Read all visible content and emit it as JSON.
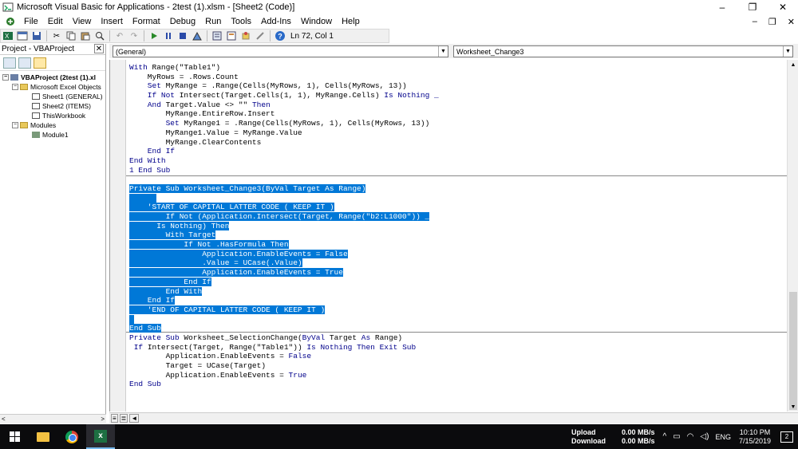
{
  "window": {
    "title": "Microsoft Visual Basic for Applications - 2test (1).xlsm - [Sheet2 (Code)]",
    "minimize": "–",
    "restore": "❐",
    "close": "✕"
  },
  "menu": {
    "items": [
      "File",
      "Edit",
      "View",
      "Insert",
      "Format",
      "Debug",
      "Run",
      "Tools",
      "Add-Ins",
      "Window",
      "Help"
    ],
    "mdi_minimize": "–",
    "mdi_restore": "❐",
    "mdi_close": "✕"
  },
  "toolbar": {
    "position": "Ln 72, Col 1"
  },
  "project": {
    "header": "Project - VBAProject",
    "close": "✕",
    "tree": [
      {
        "label": "VBAProject (2test (1).xl",
        "level": 0,
        "toggle": "−",
        "icon": "project-icon",
        "bold": true
      },
      {
        "label": "Microsoft Excel Objects",
        "level": 1,
        "toggle": "−",
        "icon": "folder-icon"
      },
      {
        "label": "Sheet1 (GENERAL)",
        "level": 2,
        "toggle": "",
        "icon": "sheet-icon"
      },
      {
        "label": "Sheet2 (ITEMS)",
        "level": 2,
        "toggle": "",
        "icon": "sheet-icon"
      },
      {
        "label": "ThisWorkbook",
        "level": 2,
        "toggle": "",
        "icon": "workbook-icon"
      },
      {
        "label": "Modules",
        "level": 1,
        "toggle": "−",
        "icon": "folder-icon"
      },
      {
        "label": "Module1",
        "level": 2,
        "toggle": "",
        "icon": "module-icon"
      }
    ],
    "scroll_left": "<",
    "scroll_right": ">"
  },
  "code": {
    "object_combo": "(General)",
    "procedure_combo": "Worksheet_Change3",
    "combo_arrow": "▼",
    "block1": [
      [
        {
          "t": "With ",
          "k": 1
        },
        {
          "t": "Range(\"Table1\")",
          "k": 0
        }
      ],
      [
        {
          "t": "    MyRows = .Rows.Count",
          "k": 0
        }
      ],
      [
        {
          "t": "    Set ",
          "k": 1
        },
        {
          "t": "MyRange = .Range(Cells(MyRows, 1), Cells(MyRows, 13))",
          "k": 0
        }
      ],
      [
        {
          "t": "    If Not ",
          "k": 1
        },
        {
          "t": "Intersect(Target.Cells(1, 1), MyRange.Cells) ",
          "k": 0
        },
        {
          "t": "Is Nothing _",
          "k": 1
        }
      ],
      [
        {
          "t": "    And ",
          "k": 1
        },
        {
          "t": "Target.Value <> \"\" ",
          "k": 0
        },
        {
          "t": "Then",
          "k": 1
        }
      ],
      [
        {
          "t": "        MyRange.EntireRow.Insert",
          "k": 0
        }
      ],
      [
        {
          "t": "        Set ",
          "k": 1
        },
        {
          "t": "MyRange1 = .Range(Cells(MyRows, 1), Cells(MyRows, 13))",
          "k": 0
        }
      ],
      [
        {
          "t": "        MyRange1.Value = MyRange.Value",
          "k": 0
        }
      ],
      [
        {
          "t": "        MyRange.ClearContents",
          "k": 0
        }
      ],
      [
        {
          "t": "    End If",
          "k": 1
        }
      ],
      [
        {
          "t": "End With",
          "k": 1
        }
      ],
      [
        {
          "t": "1 End Sub",
          "k": 1
        }
      ]
    ],
    "block2_selected": [
      "Private Sub Worksheet_Change3(ByVal Target As Range)",
      "      ",
      "    'START OF CAPITAL LATTER CODE ( KEEP IT )",
      "        If Not (Application.Intersect(Target, Range(\"b2:L1000\")) _",
      "      Is Nothing) Then",
      "        With Target",
      "            If Not .HasFormula Then",
      "                Application.EnableEvents = False",
      "                .Value = UCase(.Value)",
      "                Application.EnableEvents = True",
      "            End If",
      "        End With",
      "    End If",
      "    'END OF CAPITAL LATTER CODE ( KEEP IT )",
      " ",
      "End Sub"
    ],
    "block3": [
      [
        {
          "t": "Private Sub ",
          "k": 1
        },
        {
          "t": "Worksheet_SelectionChange(",
          "k": 0
        },
        {
          "t": "ByVal ",
          "k": 1
        },
        {
          "t": "Target ",
          "k": 0
        },
        {
          "t": "As ",
          "k": 1
        },
        {
          "t": "Range)",
          "k": 0
        }
      ],
      [
        {
          "t": " If ",
          "k": 1
        },
        {
          "t": "Intersect(Target, Range(\"Table1\")) ",
          "k": 0
        },
        {
          "t": "Is Nothing Then Exit Sub",
          "k": 1
        }
      ],
      [
        {
          "t": "        Application.EnableEvents = ",
          "k": 0
        },
        {
          "t": "False",
          "k": 1
        }
      ],
      [
        {
          "t": "        Target = UCase(Target)",
          "k": 0
        }
      ],
      [
        {
          "t": "        Application.EnableEvents = ",
          "k": 0
        },
        {
          "t": "True",
          "k": 1
        }
      ],
      [
        {
          "t": "End Sub",
          "k": 1
        }
      ]
    ]
  },
  "taskbar": {
    "net_upload_label": "Upload",
    "net_upload_value": "0.00 MB/s",
    "net_download_label": "Download",
    "net_download_value": "0.00 MB/s",
    "language": "ENG",
    "time": "10:10 PM",
    "date": "7/15/2019",
    "notifications": "2"
  },
  "colors": {
    "keyword": "#00008b",
    "selection": "#0078d7",
    "taskbar": "#0b0b0d"
  }
}
